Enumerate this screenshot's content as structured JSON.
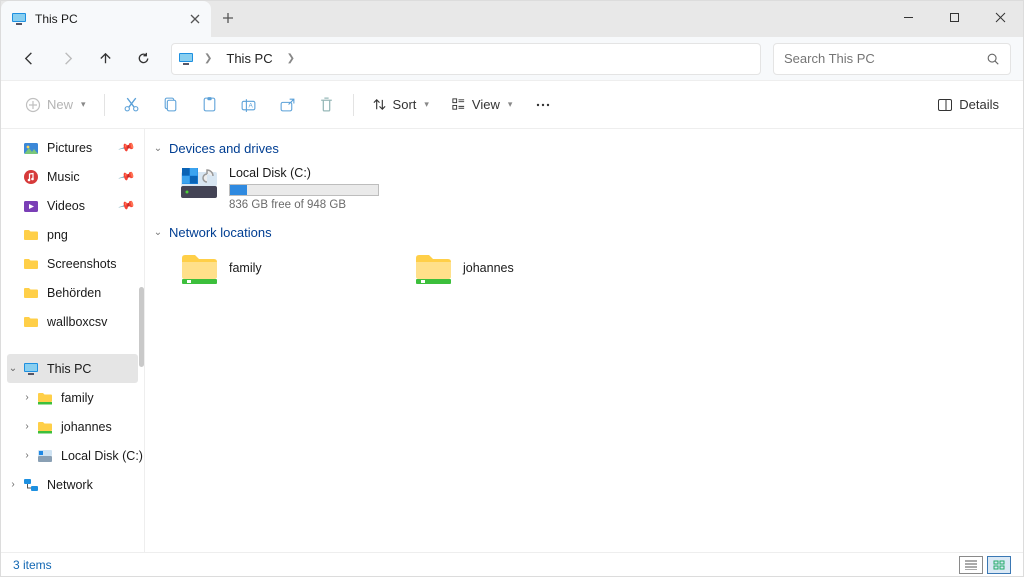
{
  "window": {
    "tab_title": "This PC"
  },
  "address": {
    "location": "This PC"
  },
  "search": {
    "placeholder": "Search This PC"
  },
  "toolbar": {
    "new_label": "New",
    "sort_label": "Sort",
    "view_label": "View",
    "details_label": "Details"
  },
  "sidebar": {
    "quick": [
      {
        "label": "Pictures",
        "pinned": true
      },
      {
        "label": "Music",
        "pinned": true
      },
      {
        "label": "Videos",
        "pinned": true
      },
      {
        "label": "png",
        "pinned": false
      },
      {
        "label": "Screenshots",
        "pinned": false
      },
      {
        "label": "Behörden",
        "pinned": false
      },
      {
        "label": "wallboxcsv",
        "pinned": false
      }
    ],
    "this_pc_label": "This PC",
    "tree": [
      {
        "label": "family"
      },
      {
        "label": "johannes"
      },
      {
        "label": "Local Disk (C:)"
      }
    ],
    "network_label": "Network"
  },
  "content": {
    "group_devices": "Devices and drives",
    "drive": {
      "name": "Local Disk (C:)",
      "free_text": "836 GB free of 948 GB"
    },
    "group_network": "Network locations",
    "locations": [
      {
        "name": "family"
      },
      {
        "name": "johannes"
      }
    ]
  },
  "status": {
    "count_text": "3 items"
  }
}
